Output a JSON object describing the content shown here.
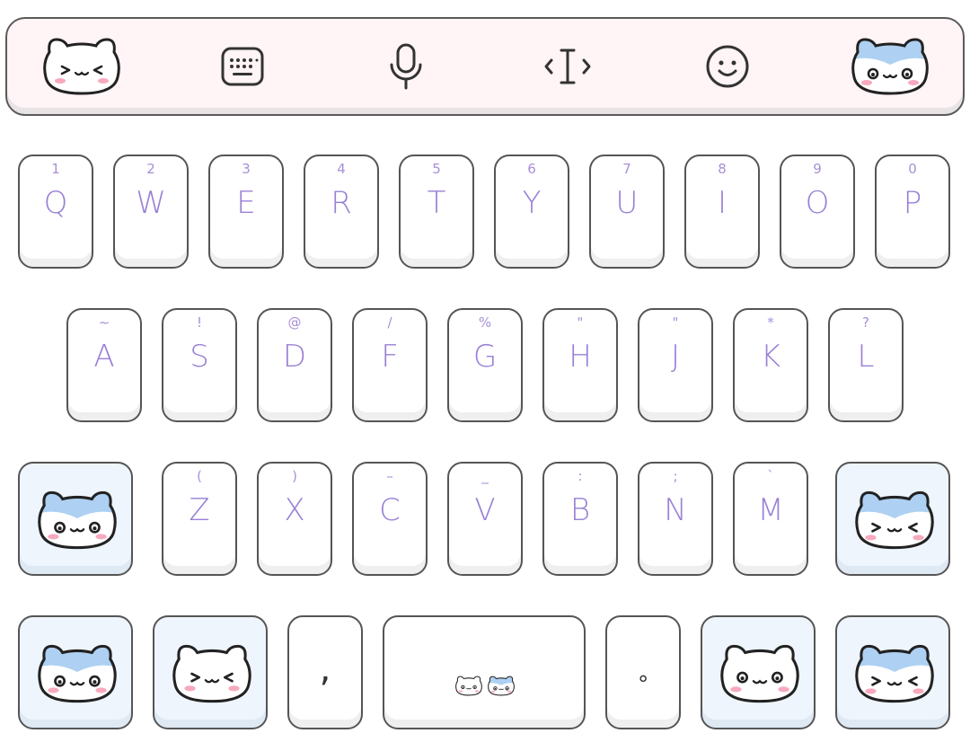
{
  "toolbar": {
    "items": [
      {
        "name": "cat-face-white-icon"
      },
      {
        "name": "keyboard-icon"
      },
      {
        "name": "microphone-icon"
      },
      {
        "name": "text-cursor-icon"
      },
      {
        "name": "smiley-icon"
      },
      {
        "name": "cat-face-blue-icon"
      }
    ]
  },
  "rows": {
    "row1": [
      {
        "letter": "Q",
        "hint": "1"
      },
      {
        "letter": "W",
        "hint": "2"
      },
      {
        "letter": "E",
        "hint": "3"
      },
      {
        "letter": "R",
        "hint": "4"
      },
      {
        "letter": "T",
        "hint": "5"
      },
      {
        "letter": "Y",
        "hint": "6"
      },
      {
        "letter": "U",
        "hint": "7"
      },
      {
        "letter": "I",
        "hint": "8"
      },
      {
        "letter": "O",
        "hint": "9"
      },
      {
        "letter": "P",
        "hint": "0"
      }
    ],
    "row2": [
      {
        "letter": "A",
        "hint": "~"
      },
      {
        "letter": "S",
        "hint": "!"
      },
      {
        "letter": "D",
        "hint": "@"
      },
      {
        "letter": "F",
        "hint": "/"
      },
      {
        "letter": "G",
        "hint": "%"
      },
      {
        "letter": "H",
        "hint": "\""
      },
      {
        "letter": "J",
        "hint": "\""
      },
      {
        "letter": "K",
        "hint": "*"
      },
      {
        "letter": "L",
        "hint": "?"
      }
    ],
    "row3": [
      {
        "letter": "Z",
        "hint": "("
      },
      {
        "letter": "X",
        "hint": ")"
      },
      {
        "letter": "C",
        "hint": "–"
      },
      {
        "letter": "V",
        "hint": "_"
      },
      {
        "letter": "B",
        "hint": ":"
      },
      {
        "letter": "N",
        "hint": ";"
      },
      {
        "letter": "M",
        "hint": "`"
      }
    ]
  },
  "bottom": {
    "comma": ",",
    "period": "∘"
  },
  "colors": {
    "letter": "#9980d6",
    "toolbar_bg": "#fff4f6",
    "cat_blue": "#aed0f2",
    "blush": "#f7a9bd"
  }
}
